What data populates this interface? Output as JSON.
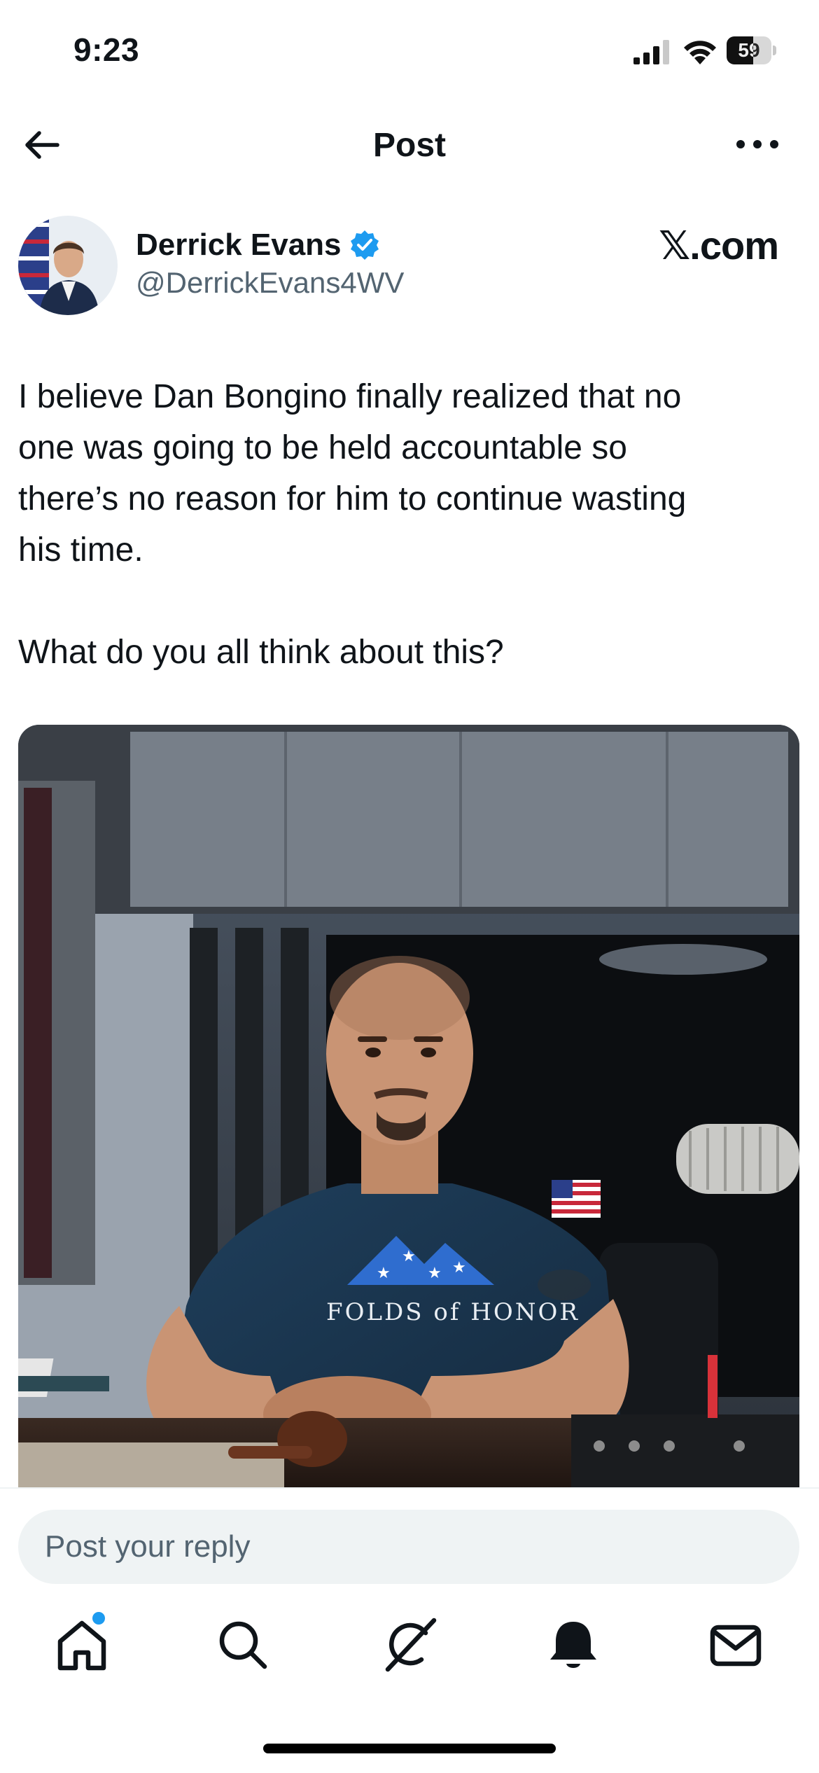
{
  "status_bar": {
    "time": "9:23",
    "battery_level": "59",
    "battery_fraction": 0.59,
    "icons": [
      "cellular-signal-icon",
      "wifi-icon",
      "battery-icon"
    ]
  },
  "nav": {
    "title": "Post",
    "back_icon": "arrow-left-icon",
    "more_icon": "ellipsis-icon"
  },
  "post": {
    "author_name": "Derrick Evans",
    "author_handle": "@DerrickEvans4WV",
    "verified": true,
    "source": "𝕏.com",
    "text": "I believe Dan Bongino finally realized that no\none was going to be held accountable so\nthere’s no reason for him to continue wasting\nhis time.\n\nWhat do you all think about this?",
    "image_shirt_text": "FOLDS of HONOR"
  },
  "reply": {
    "placeholder": "Post your reply"
  },
  "tab_bar": {
    "items": [
      "home-icon",
      "search-icon",
      "grok-icon",
      "notifications-icon",
      "messages-icon"
    ],
    "home_has_badge": true
  },
  "colors": {
    "accent": "#1d9bf0",
    "text_primary": "#0f1419",
    "text_secondary": "#536471",
    "input_bg": "#eff3f4"
  }
}
